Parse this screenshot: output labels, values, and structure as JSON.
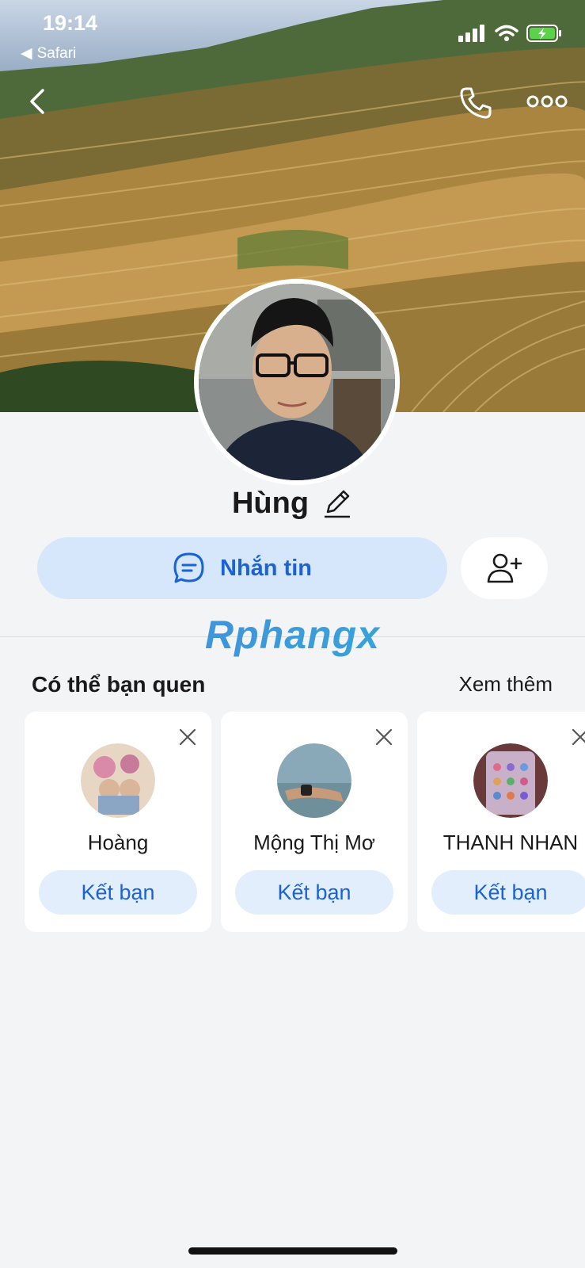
{
  "status_bar": {
    "time": "19:14",
    "back_app": "Safari"
  },
  "profile": {
    "name": "Hùng"
  },
  "actions": {
    "message_label": "Nhắn tin"
  },
  "watermark": "Rphangx",
  "suggestions": {
    "title": "Có thể bạn quen",
    "see_more": "Xem thêm",
    "items": [
      {
        "name": "Hoàng",
        "button": "Kết bạn"
      },
      {
        "name": "Mộng Thị Mơ",
        "button": "Kết bạn"
      },
      {
        "name": "THANH NHAN",
        "button": "Kết bạn"
      }
    ]
  },
  "colors": {
    "accent": "#1b63d4",
    "message_bg": "#d6e6fb",
    "page_bg": "#f3f4f6"
  }
}
